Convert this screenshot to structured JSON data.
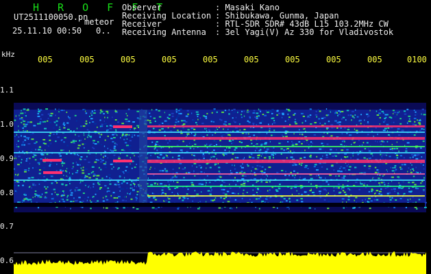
{
  "header": {
    "title": "H R O F F T",
    "filename": "UT2511100050.pn",
    "meteor_label": "meteor",
    "datetime": "25.11.10 00:50",
    "count": "0.."
  },
  "info": [
    {
      "label": "Observer",
      "value": ": Masaki Kano"
    },
    {
      "label": "Receiving Location",
      "value": ": Shibukawa, Gunma, Japan"
    },
    {
      "label": "Receiver",
      "value": ": RTL-SDR SDR# 43dB L15 103.2MHz CW"
    },
    {
      "label": "Receiving Antenna",
      "value": ": 3el Yagi(V) Az 330 for Vladivostok"
    }
  ],
  "axis": {
    "unit": "kHz",
    "y_ticks": [
      "1.1",
      "1.0",
      "0.9",
      "0.8",
      "0.7",
      "0.6"
    ],
    "x_ticks": [
      "005",
      "005",
      "005",
      "005",
      "005",
      "005",
      "005",
      "005",
      "005",
      "0100"
    ]
  },
  "colors": {
    "background": "#000000",
    "title": "#18e018",
    "x_ticks": "#ffff40",
    "noise_floor": "#ffff00",
    "hot": "#ff3070"
  }
}
